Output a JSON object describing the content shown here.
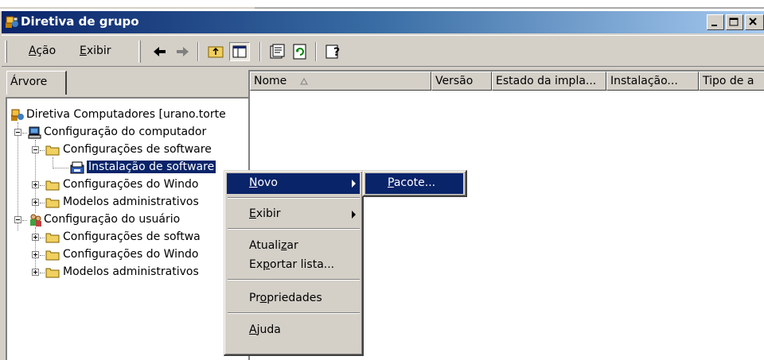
{
  "window": {
    "title": "Diretiva de grupo"
  },
  "menubar": {
    "items": [
      {
        "label": "Ação",
        "accel": "A"
      },
      {
        "label": "Exibir",
        "accel": "E"
      }
    ],
    "toolbar_icons": [
      "back-arrow-icon",
      "forward-arrow-icon",
      "up-folder-icon",
      "show-hide-tree-icon",
      "properties-icon",
      "refresh-icon",
      "help-icon"
    ]
  },
  "tree_tab": {
    "label": "Árvore"
  },
  "tree": [
    {
      "label": "Diretiva Computadores [urano.torte",
      "level": 0,
      "icon": "policy-icon"
    },
    {
      "label": "Configuração do computador",
      "level": 1,
      "icon": "computer-icon",
      "expander": "minus"
    },
    {
      "label": "Configurações de software",
      "level": 2,
      "icon": "folder-icon",
      "expander": "minus"
    },
    {
      "label": "Instalação de software",
      "level": 3,
      "icon": "software-install-icon",
      "selected": true
    },
    {
      "label": "Configurações do Windo",
      "level": 2,
      "icon": "folder-icon",
      "expander": "plus"
    },
    {
      "label": "Modelos administrativos",
      "level": 2,
      "icon": "folder-icon",
      "expander": "plus"
    },
    {
      "label": "Configuração do usuário",
      "level": 1,
      "icon": "users-icon",
      "expander": "minus"
    },
    {
      "label": "Configurações de softwa",
      "level": 2,
      "icon": "folder-icon",
      "expander": "plus"
    },
    {
      "label": "Configurações do Windo",
      "level": 2,
      "icon": "folder-icon",
      "expander": "plus"
    },
    {
      "label": "Modelos administrativos",
      "level": 2,
      "icon": "folder-icon",
      "expander": "plus"
    }
  ],
  "list": {
    "columns": [
      "Nome",
      "Versão",
      "Estado da impla...",
      "Instalação...",
      "Tipo de a"
    ]
  },
  "context_menu": {
    "items": [
      {
        "label": "Novo",
        "accel": "N",
        "submenu": true,
        "highlighted": true
      },
      {
        "label": "Exibir",
        "accel": "E",
        "submenu": true
      },
      {
        "label": "Atualizar",
        "accel": "z"
      },
      {
        "label": "Exportar lista...",
        "accel": "p"
      },
      {
        "label": "Propriedades",
        "accel": "o"
      },
      {
        "label": "Ajuda",
        "accel": "A"
      }
    ]
  },
  "submenu": {
    "items": [
      {
        "label": "Pacote...",
        "accel": "P",
        "highlighted": true
      }
    ]
  },
  "colors": {
    "titlebar": "#0a246a",
    "selection": "#0a246a",
    "face": "#d4d0c8"
  }
}
